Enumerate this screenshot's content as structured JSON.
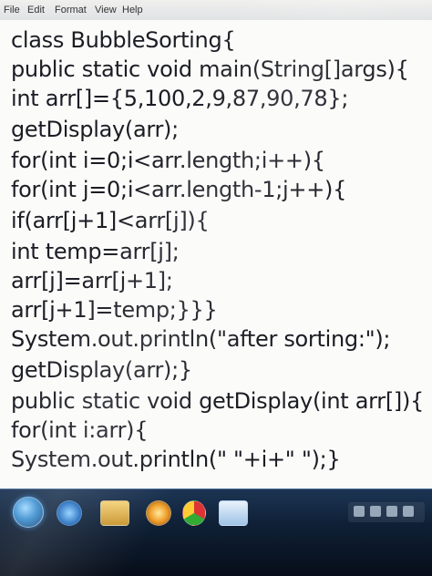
{
  "menu": {
    "file": "File",
    "edit": "Edit",
    "format": "Format",
    "view": "View",
    "help": "Help"
  },
  "code_lines": [
    "class BubbleSorting{",
    "public static void main(String[]args){",
    "int arr[]={5,100,2,9,87,90,78};",
    "getDisplay(arr);",
    "for(int i=0;i<arr.length;i++){",
    "for(int j=0;i<arr.length-1;j++){",
    "if(arr[j+1]<arr[j]){",
    "int temp=arr[j];",
    "arr[j]=arr[j+1];",
    "arr[j+1]=temp;}}}",
    "System.out.println(\"after sorting:\");",
    "getDisplay(arr);}",
    "public static void getDisplay(int arr[]){",
    "for(int i:arr){",
    "System.out.println(\" \"+i+\" \");}"
  ],
  "taskbar": {
    "icons": [
      "start-orb",
      "ie-icon",
      "folder-icon",
      "media-icon",
      "chrome-icon",
      "notepad-icon"
    ]
  }
}
